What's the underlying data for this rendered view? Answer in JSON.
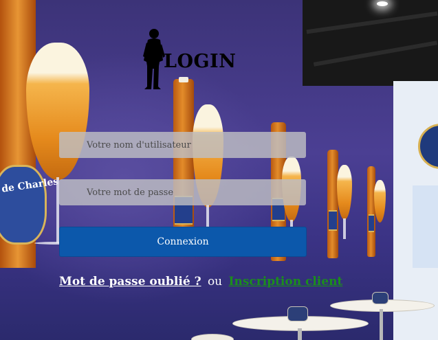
{
  "logo": {
    "text": "LOGIN"
  },
  "form": {
    "username_placeholder": "Votre nom d'utilisateur",
    "password_placeholder": "Votre mot de passe",
    "submit_label": "Connexion"
  },
  "links": {
    "forgot_password": "Mot de passe oublié ?",
    "separator": "ou",
    "signup": "Inscription client"
  },
  "background": {
    "left_label_text": "de Charles"
  },
  "colors": {
    "button": "#0c58ab",
    "signup_link": "#1b8f1b",
    "forgot_link": "#ffffff"
  }
}
